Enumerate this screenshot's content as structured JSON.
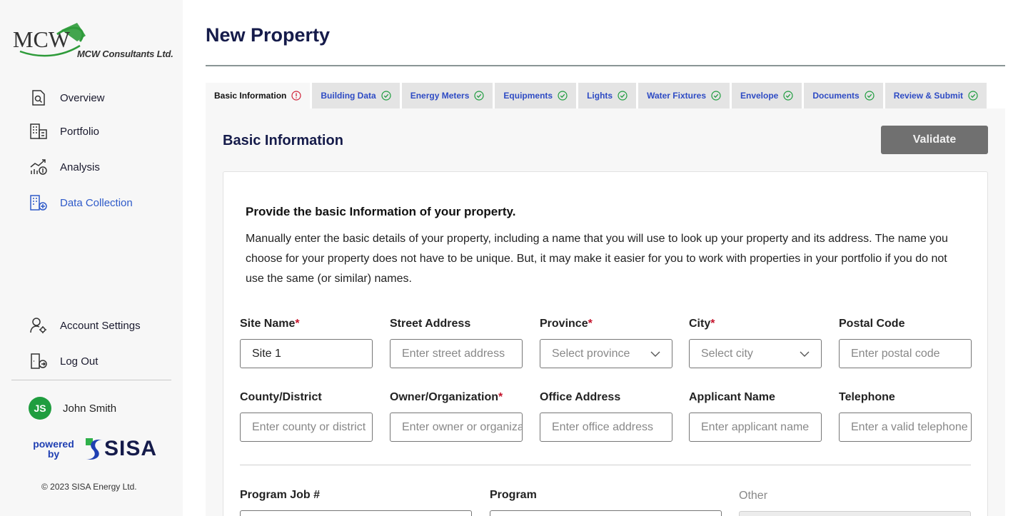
{
  "sidebar": {
    "logo_text": "MCW",
    "logo_subtitle": "MCW Consultants Ltd.",
    "nav": [
      {
        "label": "Overview",
        "icon": "overview-icon"
      },
      {
        "label": "Portfolio",
        "icon": "portfolio-icon"
      },
      {
        "label": "Analysis",
        "icon": "analysis-icon"
      },
      {
        "label": "Data Collection",
        "icon": "data-collection-icon",
        "active": true
      }
    ],
    "bottom_nav": [
      {
        "label": "Account Settings",
        "icon": "account-settings-icon"
      },
      {
        "label": "Log Out",
        "icon": "log-out-icon"
      }
    ],
    "user": {
      "initials": "JS",
      "name": "John Smith"
    },
    "powered_by": "powered by",
    "brand": "SISA",
    "copyright": "© 2023 SISA Energy Ltd."
  },
  "header": {
    "title": "New Property"
  },
  "tabs": [
    {
      "label": "Basic Information",
      "status": "error",
      "active": true
    },
    {
      "label": "Building Data",
      "status": "ok"
    },
    {
      "label": "Energy Meters",
      "status": "ok"
    },
    {
      "label": "Equipments",
      "status": "ok"
    },
    {
      "label": "Lights",
      "status": "ok"
    },
    {
      "label": "Water Fixtures",
      "status": "ok"
    },
    {
      "label": "Envelope",
      "status": "ok"
    },
    {
      "label": "Documents",
      "status": "ok"
    },
    {
      "label": "Review & Submit",
      "status": "ok"
    }
  ],
  "panel": {
    "title": "Basic Information",
    "validate_label": "Validate",
    "heading": "Provide the basic Information of your property.",
    "description": "Manually enter the basic details of your property, including a name that you will use to look up your property and its address. The name you choose for your property does not have to be unique. But, it may make it easier for you to work with properties in your portfolio if you do not use the same (or similar) names."
  },
  "form": {
    "site_name": {
      "label": "Site Name",
      "required": "*",
      "value": "Site 1"
    },
    "street_address": {
      "label": "Street Address",
      "placeholder": "Enter street address"
    },
    "province": {
      "label": "Province",
      "required": "*",
      "placeholder": "Select province"
    },
    "city": {
      "label": "City",
      "required": "*",
      "placeholder": "Select city"
    },
    "postal_code": {
      "label": "Postal Code",
      "placeholder": "Enter postal code"
    },
    "county": {
      "label": "County/District",
      "placeholder": "Enter county or district"
    },
    "owner": {
      "label": "Owner/Organization",
      "required": "*",
      "placeholder": "Enter owner or organization"
    },
    "office_address": {
      "label": "Office Address",
      "placeholder": "Enter office address"
    },
    "applicant_name": {
      "label": "Applicant Name",
      "placeholder": "Enter applicant name"
    },
    "telephone": {
      "label": "Telephone",
      "placeholder": "Enter a valid telephone"
    },
    "program_job": {
      "label": "Program Job #"
    },
    "program": {
      "label": "Program"
    },
    "other": {
      "label": "Other"
    }
  },
  "colors": {
    "accent": "#2e5ac9",
    "navy": "#151b4a",
    "required": "#c4132b",
    "ok": "#1f9d3f",
    "error": "#d0243a"
  }
}
